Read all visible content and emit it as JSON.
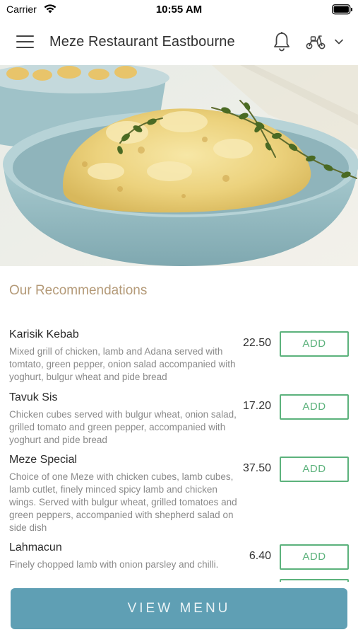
{
  "status_bar": {
    "carrier": "Carrier",
    "time": "10:55 AM"
  },
  "header": {
    "title": "Meze Restaurant Eastbourne",
    "icons": [
      "menu-icon",
      "bell-icon",
      "scooter-icon",
      "chevron-down-icon"
    ]
  },
  "hero": {
    "image": "hummus-bowl-with-thyme"
  },
  "recommendations": {
    "title": "Our Recommendations",
    "add_label": "ADD",
    "items": [
      {
        "name": "Karisik Kebab",
        "description": "Mixed grill of chicken, lamb and Adana served with tomtato, green pepper, onion salad accompanied with yoghurt, bulgur wheat and pide bread",
        "price": "22.50"
      },
      {
        "name": "Tavuk Sis",
        "description": "Chicken cubes served with bulgur wheat, onion salad, grilled tomato and green pepper, accompanied with yoghurt and pide bread",
        "price": "17.20"
      },
      {
        "name": "Meze Special",
        "description": "Choice of one Meze with chicken cubes, lamb cubes, lamb cutlet, finely minced spicy lamb and chicken wings. Served with bulgur wheat, grilled tomatoes and green peppers, accompanied with shepherd salad on side dish",
        "price": "37.50"
      },
      {
        "name": "Lahmacun",
        "description": "Finely chopped lamb with onion parsley and chilli.",
        "price": "6.40"
      }
    ]
  },
  "footer": {
    "view_menu_label": "VIEW MENU"
  },
  "colors": {
    "accent_green": "#5cb27c",
    "section_title": "#b49a78",
    "view_menu_bg": "#5f9fb4"
  }
}
